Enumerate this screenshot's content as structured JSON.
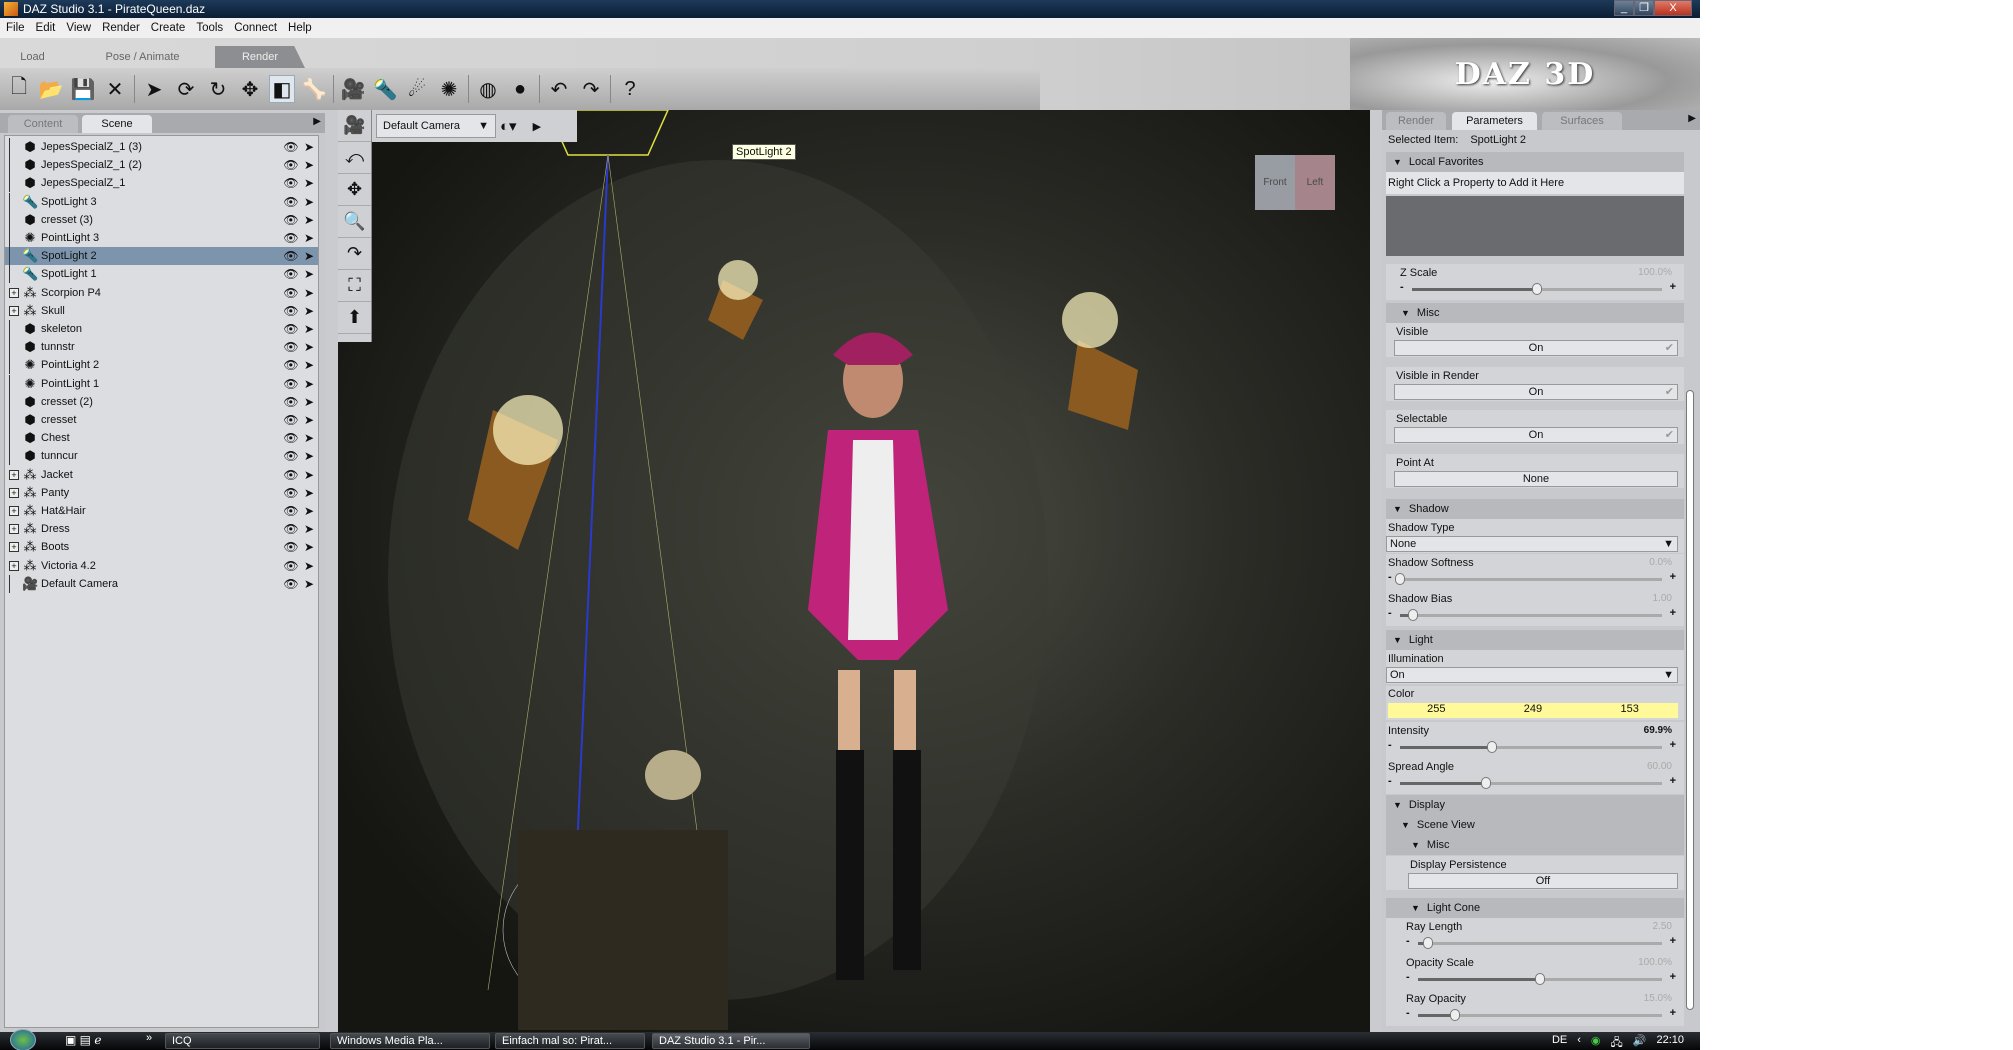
{
  "window": {
    "title": "DAZ Studio 3.1  - PirateQueen.daz",
    "minimize": "_",
    "maximize": "❐",
    "close": "X"
  },
  "menu": [
    "File",
    "Edit",
    "View",
    "Render",
    "Create",
    "Tools",
    "Connect",
    "Help"
  ],
  "modes": [
    "Load",
    "Pose / Animate",
    "Render"
  ],
  "active_mode": "Render",
  "logo": "DAZ 3D",
  "toolbar": [
    {
      "name": "new-file-icon",
      "glyph": "🗋"
    },
    {
      "name": "open-icon",
      "glyph": "📂"
    },
    {
      "name": "save-icon",
      "glyph": "💾"
    },
    {
      "name": "close-icon",
      "glyph": "✕"
    },
    "|",
    {
      "name": "select-icon",
      "glyph": "➤"
    },
    {
      "name": "universal-tool-icon",
      "glyph": "⟳"
    },
    {
      "name": "rotate-icon",
      "glyph": "↻"
    },
    {
      "name": "translate-icon",
      "glyph": "✥"
    },
    {
      "name": "region-select-icon",
      "glyph": "◧",
      "on": true
    },
    {
      "name": "bone-icon",
      "glyph": "🦴"
    },
    "|",
    {
      "name": "create-camera-icon",
      "glyph": "🎥"
    },
    {
      "name": "create-spotlight-icon",
      "glyph": "🔦"
    },
    {
      "name": "create-distant-light-icon",
      "glyph": "☄"
    },
    {
      "name": "create-pointlight-icon",
      "glyph": "✺"
    },
    "|",
    {
      "name": "render-settings-icon",
      "glyph": "◍"
    },
    {
      "name": "render-icon",
      "glyph": "●"
    },
    "|",
    {
      "name": "undo-icon",
      "glyph": "↶"
    },
    {
      "name": "redo-icon",
      "glyph": "↷"
    },
    "|",
    {
      "name": "help-icon",
      "glyph": "?"
    }
  ],
  "left_panel": {
    "tabs": [
      "Content",
      "Scene"
    ],
    "active_tab": "Scene",
    "items": [
      {
        "name": "JepesSpecialZ_1 (3)",
        "type": "object"
      },
      {
        "name": "JepesSpecialZ_1 (2)",
        "type": "object"
      },
      {
        "name": "JepesSpecialZ_1",
        "type": "object"
      },
      {
        "name": "SpotLight 3",
        "type": "spot"
      },
      {
        "name": "cresset (3)",
        "type": "object"
      },
      {
        "name": "PointLight 3",
        "type": "point"
      },
      {
        "name": "SpotLight 2",
        "type": "spot",
        "selected": true
      },
      {
        "name": "SpotLight 1",
        "type": "spot"
      },
      {
        "name": "Scorpion P4",
        "type": "group"
      },
      {
        "name": "Skull",
        "type": "group"
      },
      {
        "name": "skeleton",
        "type": "object"
      },
      {
        "name": "tunnstr",
        "type": "object"
      },
      {
        "name": "PointLight 2",
        "type": "point"
      },
      {
        "name": "PointLight 1",
        "type": "point"
      },
      {
        "name": "cresset (2)",
        "type": "object"
      },
      {
        "name": "cresset",
        "type": "object"
      },
      {
        "name": "Chest",
        "type": "object"
      },
      {
        "name": "tunncur",
        "type": "object"
      },
      {
        "name": "Jacket",
        "type": "group"
      },
      {
        "name": "Panty",
        "type": "group"
      },
      {
        "name": "Hat&Hair",
        "type": "group"
      },
      {
        "name": "Dress",
        "type": "group"
      },
      {
        "name": "Boots",
        "type": "group"
      },
      {
        "name": "Victoria 4.2",
        "type": "group"
      },
      {
        "name": "Default Camera",
        "type": "camera"
      }
    ]
  },
  "viewport": {
    "camera": "Default Camera",
    "tooltip": "SpotLight 2",
    "cube_labels": [
      "Front",
      "Left"
    ]
  },
  "right_panel": {
    "tabs": [
      "Render",
      "Parameters",
      "Surfaces"
    ],
    "active_tab": "Parameters",
    "selected_label": "Selected Item:",
    "selected_value": "SpotLight 2",
    "favorites": "Local Favorites",
    "favorites_hint": "Right Click a Property to Add it Here",
    "zscale": {
      "label": "Z Scale",
      "value": "100.0%",
      "pos": 0.5
    },
    "misc": "Misc",
    "visible": {
      "label": "Visible",
      "value": "On"
    },
    "visible_render": {
      "label": "Visible in Render",
      "value": "On"
    },
    "selectable": {
      "label": "Selectable",
      "value": "On"
    },
    "point_at": {
      "label": "Point At",
      "value": "None"
    },
    "shadow": "Shadow",
    "shadow_type": {
      "label": "Shadow Type",
      "value": "None"
    },
    "shadow_softness": {
      "label": "Shadow Softness",
      "value": "0.0%",
      "pos": 0.0
    },
    "shadow_bias": {
      "label": "Shadow Bias",
      "value": "1.00",
      "pos": 0.05
    },
    "light": "Light",
    "illumination": {
      "label": "Illumination",
      "value": "On"
    },
    "color": {
      "label": "Color",
      "r": "255",
      "g": "249",
      "b": "153",
      "hex": "#fff999"
    },
    "intensity": {
      "label": "Intensity",
      "value": "69.9%",
      "pos": 0.35
    },
    "spread_angle": {
      "label": "Spread Angle",
      "value": "60.00",
      "pos": 0.33
    },
    "display": "Display",
    "scene_view": "Scene View",
    "misc2": "Misc",
    "display_persistence": {
      "label": "Display Persistence",
      "value": "Off"
    },
    "light_cone": "Light Cone",
    "ray_length": {
      "label": "Ray Length",
      "value": "2.50",
      "pos": 0.04
    },
    "opacity_scale": {
      "label": "Opacity Scale",
      "value": "100.0%",
      "pos": 0.5
    },
    "ray_opacity": {
      "label": "Ray Opacity",
      "value": "15.0%",
      "pos": 0.15
    }
  },
  "taskbar": {
    "quick_more": "»",
    "tasks": [
      "ICQ",
      "Windows Media Pla...",
      "Einfach mal so: Pirat...",
      "DAZ Studio 3.1  - Pir..."
    ],
    "lang": "DE",
    "clock": "22:10"
  }
}
